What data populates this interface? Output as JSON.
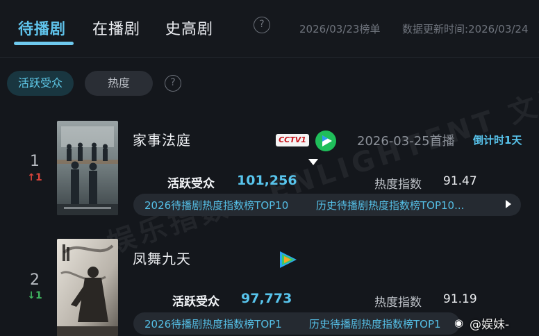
{
  "tabs": [
    {
      "label": "待播剧",
      "active": true
    },
    {
      "label": "在播剧",
      "active": false
    },
    {
      "label": "史高剧",
      "active": false
    }
  ],
  "header": {
    "help_icon": "question-circle-icon",
    "list_date": "2026/03/23榜单",
    "update_time": "数据更新时间:2026/03/24"
  },
  "filters": {
    "active_label": "活跃受众",
    "heat_label": "热度",
    "help_icon": "question-circle-icon"
  },
  "rows": [
    {
      "rank": "1",
      "trend": "↑1",
      "trend_dir": "up",
      "title": "家事法庭",
      "platforms": [
        "CCTV-1",
        "iqiyi"
      ],
      "cctv_label": "CCTV1",
      "release": "2026-03-25首播",
      "countdown": "倒计时1天",
      "audience_label": "活跃受众",
      "audience_value": "101,256",
      "heat_label": "热度指数",
      "heat_value": "91.47",
      "tags": [
        "2026待播剧热度指数榜TOP10",
        "历史待播剧热度指数榜TOP10..."
      ]
    },
    {
      "rank": "2",
      "trend": "↓1",
      "trend_dir": "down",
      "title": "凤舞九天",
      "platforms": [
        "tencent-video"
      ],
      "release": "",
      "countdown": "",
      "audience_label": "活跃受众",
      "audience_value": "97,773",
      "heat_label": "热度指数",
      "heat_value": "91.19",
      "tags": [
        "2026待播剧热度指数榜TOP1",
        "历史待播剧热度指数榜TOP1"
      ]
    }
  ],
  "watermark": "AI 娱乐指数  ENLIGHTENT 文漫数据",
  "weibo_credit": "@娱妹-",
  "colors": {
    "background": "#14171c",
    "accent": "#58c4ec",
    "trend_up": "#d9443b",
    "trend_down": "#3fb35f"
  }
}
